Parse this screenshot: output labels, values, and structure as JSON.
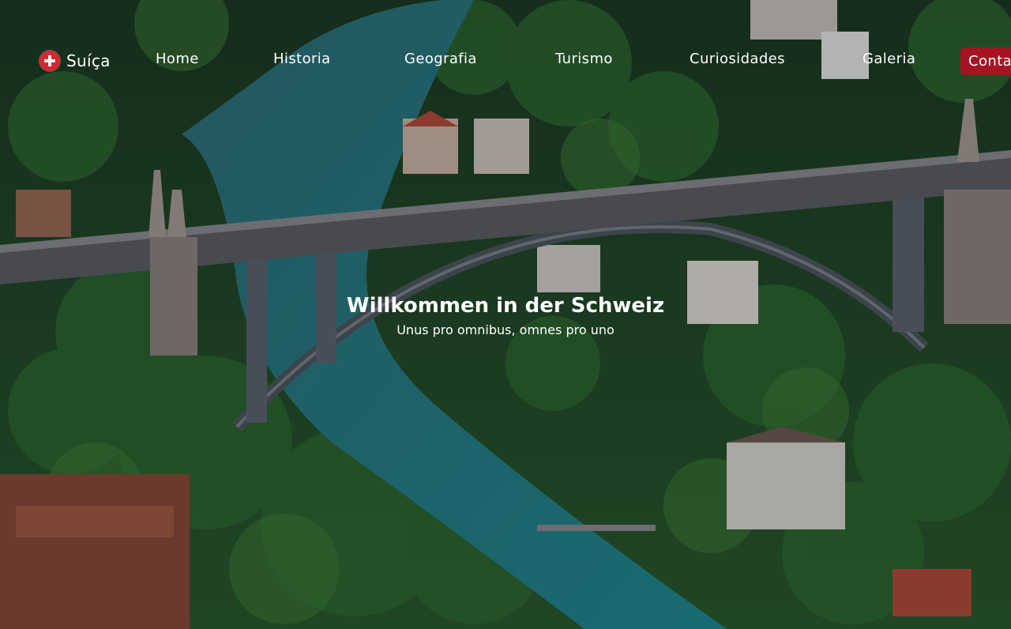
{
  "brand": {
    "name": "Suíça",
    "flag_icon": "swiss-flag-icon"
  },
  "nav": {
    "links": [
      {
        "label": "Home"
      },
      {
        "label": "Historia"
      },
      {
        "label": "Geografia"
      },
      {
        "label": "Turismo"
      },
      {
        "label": "Curiosidades"
      },
      {
        "label": "Galeria"
      }
    ],
    "contact_label": "Contato"
  },
  "hero": {
    "title": "Willkommen in der Schweiz",
    "subtitle": "Unus pro omnibus, omnes pro uno"
  },
  "colors": {
    "accent": "#a51423",
    "flag_red": "#d8262e",
    "text": "#ffffff"
  }
}
